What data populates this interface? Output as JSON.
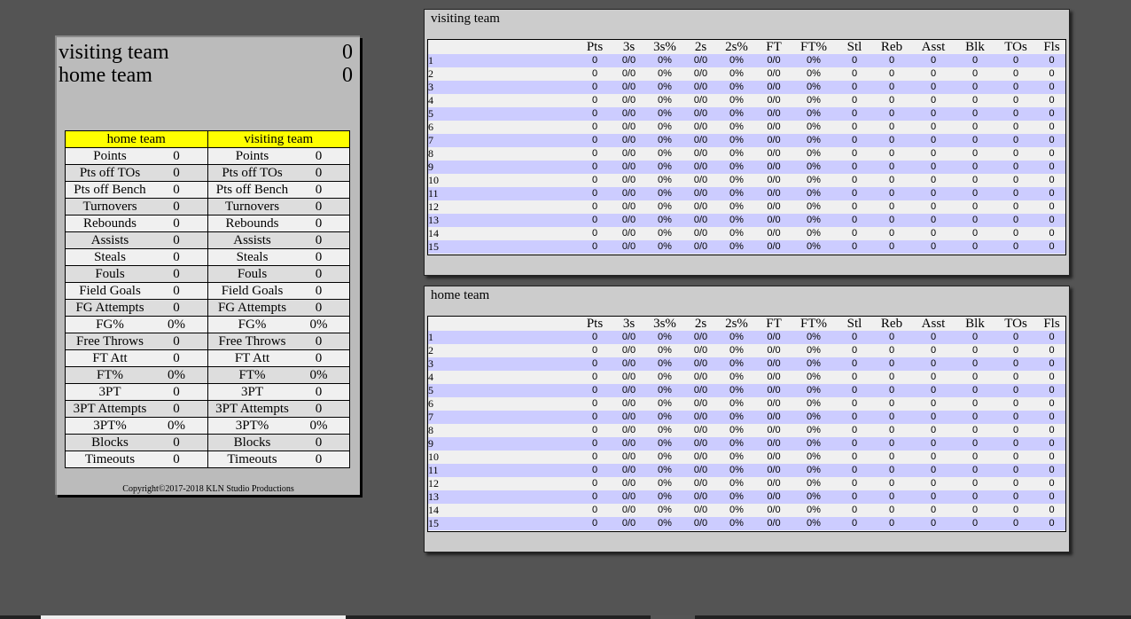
{
  "scoreboard": {
    "visiting_name": "visiting team",
    "visiting_score": "0",
    "home_name": "home team",
    "home_score": "0"
  },
  "team_stats": {
    "headers": [
      "home team",
      "visiting team"
    ],
    "rows": [
      [
        "Points",
        "0",
        "0"
      ],
      [
        "Pts off TOs",
        "0",
        "0"
      ],
      [
        "Pts off Bench",
        "0",
        "0"
      ],
      [
        "Turnovers",
        "0",
        "0"
      ],
      [
        "Rebounds",
        "0",
        "0"
      ],
      [
        "Assists",
        "0",
        "0"
      ],
      [
        "Steals",
        "0",
        "0"
      ],
      [
        "Fouls",
        "0",
        "0"
      ],
      [
        "Field Goals",
        "0",
        "0"
      ],
      [
        "FG Attempts",
        "0",
        "0"
      ],
      [
        "FG%",
        "0%",
        "0%"
      ],
      [
        "Free Throws",
        "0",
        "0"
      ],
      [
        "FT Att",
        "0",
        "0"
      ],
      [
        "FT%",
        "0%",
        "0%"
      ],
      [
        "3PT",
        "0",
        "0"
      ],
      [
        "3PT Attempts",
        "0",
        "0"
      ],
      [
        "3PT%",
        "0%",
        "0%"
      ],
      [
        "Blocks",
        "0",
        "0"
      ],
      [
        "Timeouts",
        "0",
        "0"
      ]
    ]
  },
  "copyright": "Copyright©2017-2018 KLN Studio Productions",
  "columns": [
    "",
    "Pts",
    "3s",
    "3s%",
    "2s",
    "2s%",
    "FT",
    "FT%",
    "Stl",
    "Reb",
    "Asst",
    "Blk",
    "TOs",
    "Fls"
  ],
  "box_scores": [
    {
      "title": "visiting team",
      "rows": [
        [
          "1",
          "0",
          "0/0",
          "0%",
          "0/0",
          "0%",
          "0/0",
          "0%",
          "0",
          "0",
          "0",
          "0",
          "0",
          "0"
        ],
        [
          "2",
          "0",
          "0/0",
          "0%",
          "0/0",
          "0%",
          "0/0",
          "0%",
          "0",
          "0",
          "0",
          "0",
          "0",
          "0"
        ],
        [
          "3",
          "0",
          "0/0",
          "0%",
          "0/0",
          "0%",
          "0/0",
          "0%",
          "0",
          "0",
          "0",
          "0",
          "0",
          "0"
        ],
        [
          "4",
          "0",
          "0/0",
          "0%",
          "0/0",
          "0%",
          "0/0",
          "0%",
          "0",
          "0",
          "0",
          "0",
          "0",
          "0"
        ],
        [
          "5",
          "0",
          "0/0",
          "0%",
          "0/0",
          "0%",
          "0/0",
          "0%",
          "0",
          "0",
          "0",
          "0",
          "0",
          "0"
        ],
        [
          "6",
          "0",
          "0/0",
          "0%",
          "0/0",
          "0%",
          "0/0",
          "0%",
          "0",
          "0",
          "0",
          "0",
          "0",
          "0"
        ],
        [
          "7",
          "0",
          "0/0",
          "0%",
          "0/0",
          "0%",
          "0/0",
          "0%",
          "0",
          "0",
          "0",
          "0",
          "0",
          "0"
        ],
        [
          "8",
          "0",
          "0/0",
          "0%",
          "0/0",
          "0%",
          "0/0",
          "0%",
          "0",
          "0",
          "0",
          "0",
          "0",
          "0"
        ],
        [
          "9",
          "0",
          "0/0",
          "0%",
          "0/0",
          "0%",
          "0/0",
          "0%",
          "0",
          "0",
          "0",
          "0",
          "0",
          "0"
        ],
        [
          "10",
          "0",
          "0/0",
          "0%",
          "0/0",
          "0%",
          "0/0",
          "0%",
          "0",
          "0",
          "0",
          "0",
          "0",
          "0"
        ],
        [
          "11",
          "0",
          "0/0",
          "0%",
          "0/0",
          "0%",
          "0/0",
          "0%",
          "0",
          "0",
          "0",
          "0",
          "0",
          "0"
        ],
        [
          "12",
          "0",
          "0/0",
          "0%",
          "0/0",
          "0%",
          "0/0",
          "0%",
          "0",
          "0",
          "0",
          "0",
          "0",
          "0"
        ],
        [
          "13",
          "0",
          "0/0",
          "0%",
          "0/0",
          "0%",
          "0/0",
          "0%",
          "0",
          "0",
          "0",
          "0",
          "0",
          "0"
        ],
        [
          "14",
          "0",
          "0/0",
          "0%",
          "0/0",
          "0%",
          "0/0",
          "0%",
          "0",
          "0",
          "0",
          "0",
          "0",
          "0"
        ],
        [
          "15",
          "0",
          "0/0",
          "0%",
          "0/0",
          "0%",
          "0/0",
          "0%",
          "0",
          "0",
          "0",
          "0",
          "0",
          "0"
        ]
      ]
    },
    {
      "title": "home team",
      "rows": [
        [
          "1",
          "0",
          "0/0",
          "0%",
          "0/0",
          "0%",
          "0/0",
          "0%",
          "0",
          "0",
          "0",
          "0",
          "0",
          "0"
        ],
        [
          "2",
          "0",
          "0/0",
          "0%",
          "0/0",
          "0%",
          "0/0",
          "0%",
          "0",
          "0",
          "0",
          "0",
          "0",
          "0"
        ],
        [
          "3",
          "0",
          "0/0",
          "0%",
          "0/0",
          "0%",
          "0/0",
          "0%",
          "0",
          "0",
          "0",
          "0",
          "0",
          "0"
        ],
        [
          "4",
          "0",
          "0/0",
          "0%",
          "0/0",
          "0%",
          "0/0",
          "0%",
          "0",
          "0",
          "0",
          "0",
          "0",
          "0"
        ],
        [
          "5",
          "0",
          "0/0",
          "0%",
          "0/0",
          "0%",
          "0/0",
          "0%",
          "0",
          "0",
          "0",
          "0",
          "0",
          "0"
        ],
        [
          "6",
          "0",
          "0/0",
          "0%",
          "0/0",
          "0%",
          "0/0",
          "0%",
          "0",
          "0",
          "0",
          "0",
          "0",
          "0"
        ],
        [
          "7",
          "0",
          "0/0",
          "0%",
          "0/0",
          "0%",
          "0/0",
          "0%",
          "0",
          "0",
          "0",
          "0",
          "0",
          "0"
        ],
        [
          "8",
          "0",
          "0/0",
          "0%",
          "0/0",
          "0%",
          "0/0",
          "0%",
          "0",
          "0",
          "0",
          "0",
          "0",
          "0"
        ],
        [
          "9",
          "0",
          "0/0",
          "0%",
          "0/0",
          "0%",
          "0/0",
          "0%",
          "0",
          "0",
          "0",
          "0",
          "0",
          "0"
        ],
        [
          "10",
          "0",
          "0/0",
          "0%",
          "0/0",
          "0%",
          "0/0",
          "0%",
          "0",
          "0",
          "0",
          "0",
          "0",
          "0"
        ],
        [
          "11",
          "0",
          "0/0",
          "0%",
          "0/0",
          "0%",
          "0/0",
          "0%",
          "0",
          "0",
          "0",
          "0",
          "0",
          "0"
        ],
        [
          "12",
          "0",
          "0/0",
          "0%",
          "0/0",
          "0%",
          "0/0",
          "0%",
          "0",
          "0",
          "0",
          "0",
          "0",
          "0"
        ],
        [
          "13",
          "0",
          "0/0",
          "0%",
          "0/0",
          "0%",
          "0/0",
          "0%",
          "0",
          "0",
          "0",
          "0",
          "0",
          "0"
        ],
        [
          "14",
          "0",
          "0/0",
          "0%",
          "0/0",
          "0%",
          "0/0",
          "0%",
          "0",
          "0",
          "0",
          "0",
          "0",
          "0"
        ],
        [
          "15",
          "0",
          "0/0",
          "0%",
          "0/0",
          "0%",
          "0/0",
          "0%",
          "0",
          "0",
          "0",
          "0",
          "0",
          "0"
        ]
      ]
    }
  ],
  "colors": {
    "header_yellow": "#ffff00",
    "row_lavender": "#ccccff",
    "row_light": "#f0f0f0",
    "background": "#545454"
  }
}
